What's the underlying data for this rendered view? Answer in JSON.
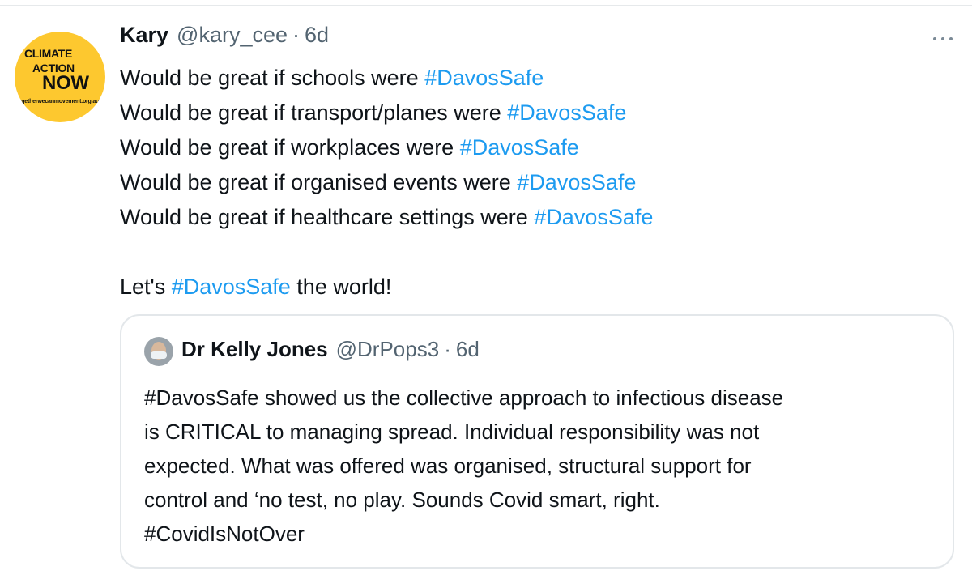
{
  "tweet": {
    "author_name": "Kary",
    "author_handle": "@kary_cee",
    "separator": "·",
    "time": "6d",
    "avatar": {
      "line1": "CLIMATE",
      "line2": "ACTION",
      "line3": "NOW",
      "url": "togetherwecanmovement.org.au",
      "background": "#fdc82f"
    },
    "more_icon": "more-horizontal-icon",
    "lines": [
      {
        "text": "Would be great if schools were ",
        "hashtag": "#DavosSafe"
      },
      {
        "text": "Would be great if transport/planes were ",
        "hashtag": "#DavosSafe"
      },
      {
        "text": "Would be great if workplaces were ",
        "hashtag": "#DavosSafe"
      },
      {
        "text": "Would be great if organised events were ",
        "hashtag": "#DavosSafe"
      },
      {
        "text": "Would be great if healthcare settings were ",
        "hashtag": "#DavosSafe"
      }
    ],
    "closing": {
      "before": "Let's ",
      "hashtag": "#DavosSafe",
      "after": " the world!"
    }
  },
  "quoted_tweet": {
    "author_name": "Dr Kelly Jones",
    "author_handle": "@DrPops3",
    "separator": "·",
    "time": "6d",
    "lines": [
      "#DavosSafe showed us the collective approach to infectious disease",
      "is CRITICAL to managing spread. Individual responsibility was not",
      "expected. What was offered was organised, structural support for",
      "control and ‘no test, no play. Sounds Covid smart, right.",
      "#CovidIsNotOver"
    ]
  },
  "colors": {
    "text": "#0f1419",
    "secondary": "#536471",
    "link": "#1d9bf0",
    "border": "#e3e7ea"
  }
}
